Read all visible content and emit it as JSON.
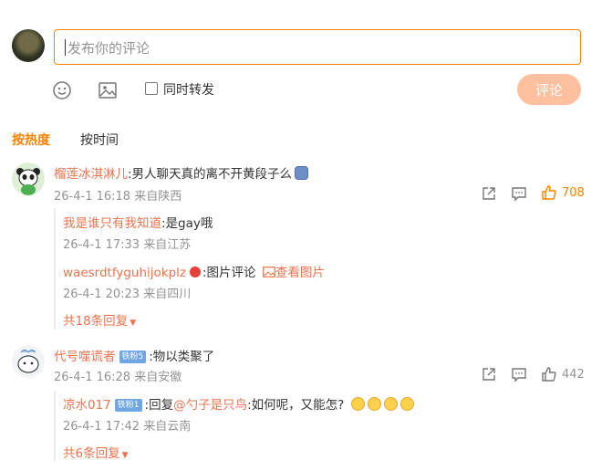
{
  "composer": {
    "placeholder": "发布你的评论",
    "repost_label": "同时转发",
    "submit_label": "评论"
  },
  "sort_tabs": [
    "按热度",
    "按时间"
  ],
  "comments": [
    {
      "user": "榴莲冰淇淋儿",
      "text": ":男人聊天真的离不开黄段子么",
      "emoji": "😅",
      "meta": "26-4-1 16:18 来自陕西",
      "likes": "708",
      "replies": [
        {
          "user": "我是谁只有我知道",
          "text": ":是gay哦",
          "meta": "26-4-1 17:33 来自江苏"
        },
        {
          "user": "waesrdtfyguhijokplz",
          "text": ":图片评论",
          "pic_label": "查看图片",
          "meta": "26-4-1 20:23 来自四川"
        }
      ],
      "more_replies": "共18条回复"
    },
    {
      "user": "代号噬谎者",
      "badge": "铁粉5",
      "text": ":物以类聚了",
      "meta": "26-4-1 16:28 来自安徽",
      "likes": "442",
      "replies": [
        {
          "user": "凉水017",
          "badge": "铁粉1",
          "prefix": ":回复",
          "mention": "@勺子是只鸟",
          "text": ":如何呢，又能怎?",
          "meta": "26-4-1 17:42 来自云南"
        }
      ],
      "more_replies": "共6条回复"
    }
  ],
  "colors": {
    "accent": "#ff8200",
    "username": "#eb7350",
    "meta": "#939393",
    "submit_disabled": "#ffc09f"
  }
}
